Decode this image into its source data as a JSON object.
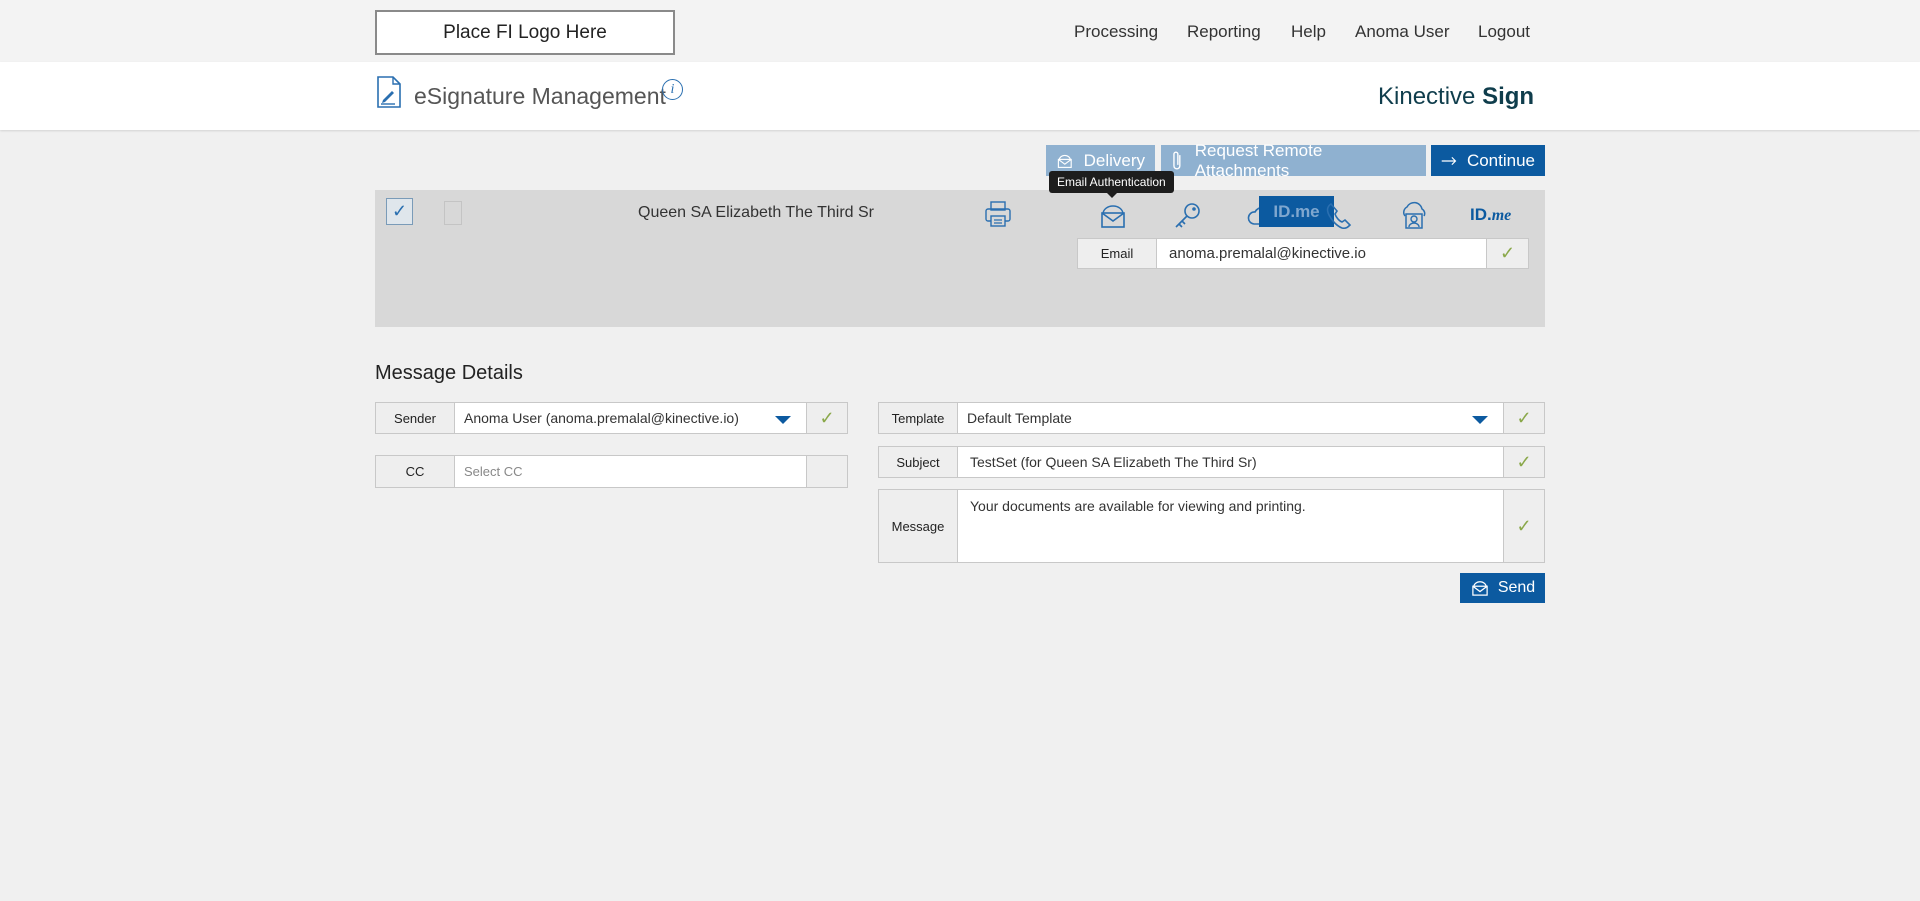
{
  "topbar": {
    "logo_text": "Place FI Logo Here",
    "nav": [
      "Processing",
      "Reporting",
      "Help",
      "Anoma User",
      "Logout"
    ]
  },
  "header": {
    "title": "eSignature Management",
    "info_glyph": "i",
    "brand_prefix": "Kinective",
    "brand_suffix": "Sign"
  },
  "actions": {
    "delivery": "Delivery",
    "request_remote": "Request Remote Attachments",
    "continue": "Continue"
  },
  "signer": {
    "name": "Queen SA Elizabeth The Third Sr",
    "tooltip": "Email Authentication",
    "idme_badge": "ID.me",
    "idme_prefix": "ID.",
    "idme_suffix": "me",
    "email_label": "Email",
    "email_value": "anoma.premalal@kinective.io"
  },
  "message_details": {
    "title": "Message Details",
    "sender_label": "Sender",
    "sender_value": "Anoma User (anoma.premalal@kinective.io)",
    "cc_label": "CC",
    "cc_placeholder": "Select CC",
    "template_label": "Template",
    "template_value": "Default Template",
    "subject_label": "Subject",
    "subject_value": "TestSet (for Queen SA Elizabeth The Third Sr)",
    "message_label": "Message",
    "message_value": "Your documents are available for viewing and printing.",
    "send": "Send"
  },
  "colors": {
    "accent": "#0c5aa0",
    "accent_light": "#8fb1d0",
    "check_green": "#8aa84a",
    "panel": "#d8d8d8"
  },
  "icons": [
    "document-sign-icon",
    "info-icon",
    "mail-icon",
    "paperclip-icon",
    "arrow-right-icon",
    "checkbox-icon",
    "printer-icon",
    "email-auth-icon",
    "key-icon",
    "cloud-icon",
    "phone-icon",
    "cloud-user-icon",
    "idme-icon",
    "checkmark-icon"
  ]
}
